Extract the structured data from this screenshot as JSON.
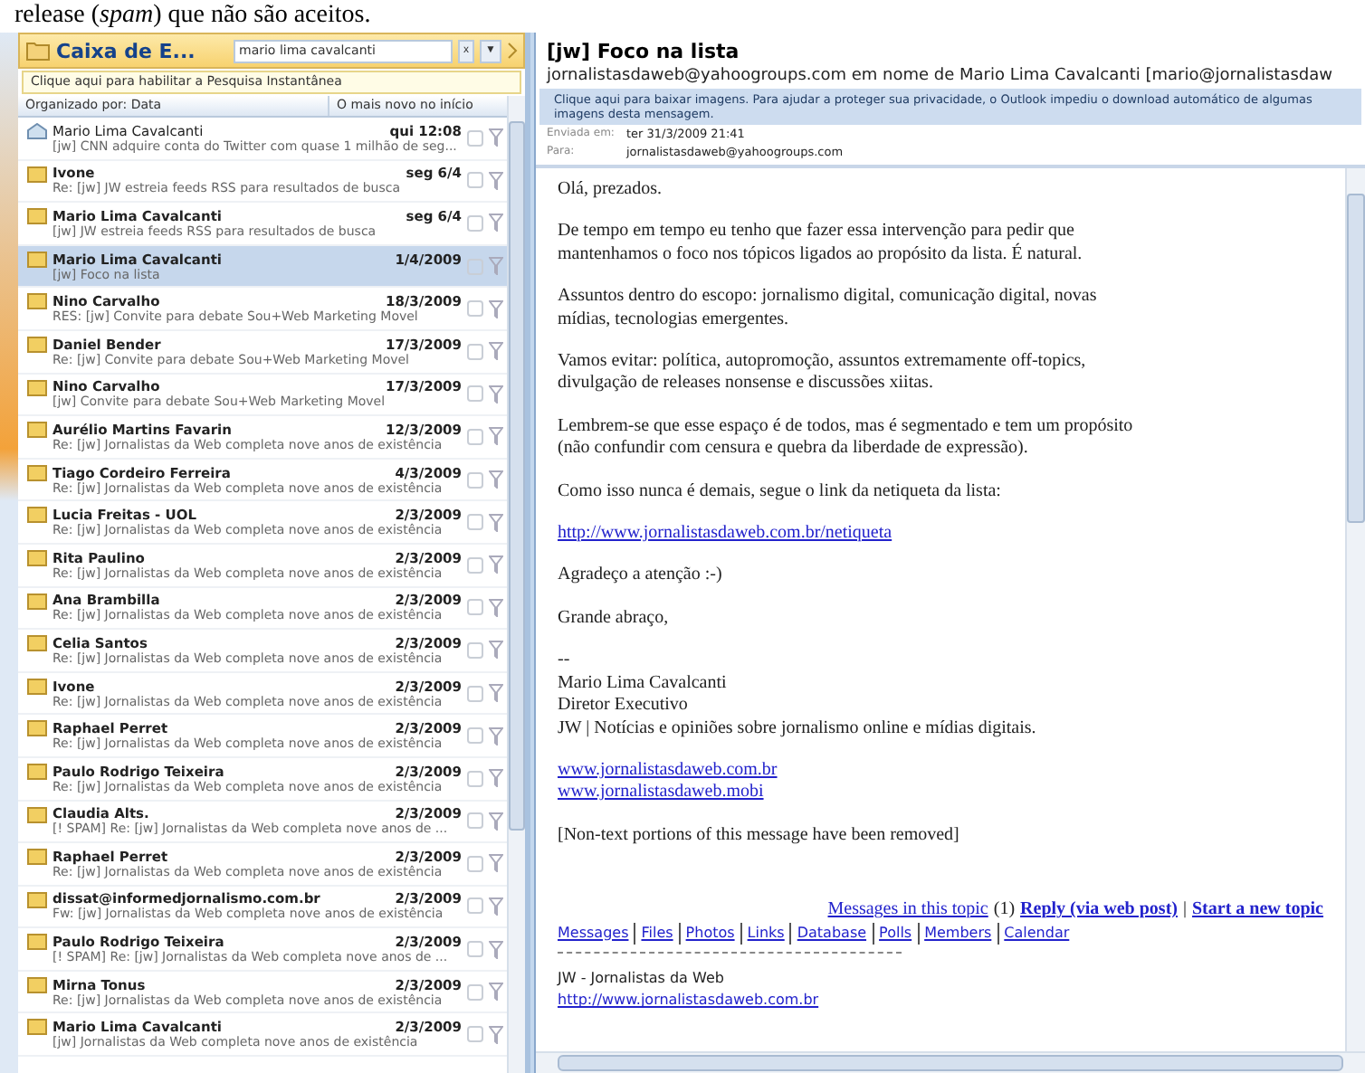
{
  "caption": "release (*spam*) que não são aceitos.",
  "mail_list": {
    "folder_title": "Caixa de E...",
    "search": {
      "value": "mario lima cavalcanti",
      "clear": "x",
      "dropdown": "▼"
    },
    "instant_search": "Clique aqui para habilitar a Pesquisa Instantânea",
    "sort": {
      "by": "Organizado por: Data",
      "order": "O mais novo no início"
    },
    "messages": [
      {
        "sender": "Mario Lima Cavalcanti",
        "date": "qui 12:08",
        "subject": "[jw] CNN adquire conta do Twitter com quase 1 milhão de seg...",
        "read": true,
        "selected": false
      },
      {
        "sender": "Ivone",
        "date": "seg 6/4",
        "subject": "Re: [jw] JW estreia feeds RSS para resultados de busca",
        "read": false,
        "selected": false
      },
      {
        "sender": "Mario Lima Cavalcanti",
        "date": "seg 6/4",
        "subject": "[jw] JW estreia feeds RSS para resultados de busca",
        "read": false,
        "selected": false
      },
      {
        "sender": "Mario Lima Cavalcanti",
        "date": "1/4/2009",
        "subject": "[jw] Foco na lista",
        "read": false,
        "selected": true
      },
      {
        "sender": "Nino Carvalho",
        "date": "18/3/2009",
        "subject": "RES: [jw] Convite para debate Sou+Web Marketing Movel",
        "read": false,
        "selected": false
      },
      {
        "sender": "Daniel Bender",
        "date": "17/3/2009",
        "subject": "Re: [jw] Convite para debate Sou+Web Marketing Movel",
        "read": false,
        "selected": false
      },
      {
        "sender": "Nino Carvalho",
        "date": "17/3/2009",
        "subject": "[jw] Convite para debate Sou+Web Marketing Movel",
        "read": false,
        "selected": false
      },
      {
        "sender": "Aurélio Martins Favarin",
        "date": "12/3/2009",
        "subject": "Re: [jw] Jornalistas da Web completa nove anos de existência",
        "read": false,
        "selected": false
      },
      {
        "sender": "Tiago Cordeiro Ferreira",
        "date": "4/3/2009",
        "subject": "Re: [jw] Jornalistas da Web completa nove anos de existência",
        "read": false,
        "selected": false
      },
      {
        "sender": "Lucia Freitas - UOL",
        "date": "2/3/2009",
        "subject": "Re: [jw] Jornalistas da Web completa nove anos de existência",
        "read": false,
        "selected": false
      },
      {
        "sender": "Rita Paulino",
        "date": "2/3/2009",
        "subject": "Re: [jw] Jornalistas da Web completa nove anos de existência",
        "read": false,
        "selected": false
      },
      {
        "sender": "Ana Brambilla",
        "date": "2/3/2009",
        "subject": "Re: [jw] Jornalistas da Web completa nove anos de existência",
        "read": false,
        "selected": false
      },
      {
        "sender": "Celia Santos",
        "date": "2/3/2009",
        "subject": "Re: [jw] Jornalistas da Web completa nove anos de existência",
        "read": false,
        "selected": false
      },
      {
        "sender": "Ivone",
        "date": "2/3/2009",
        "subject": "Re: [jw] Jornalistas da Web completa nove anos de existência",
        "read": false,
        "selected": false
      },
      {
        "sender": "Raphael Perret",
        "date": "2/3/2009",
        "subject": "Re: [jw] Jornalistas da Web completa nove anos de existência",
        "read": false,
        "selected": false
      },
      {
        "sender": "Paulo Rodrigo Teixeira",
        "date": "2/3/2009",
        "subject": "Re: [jw] Jornalistas da Web completa nove anos de existência",
        "read": false,
        "selected": false
      },
      {
        "sender": "Claudia Alts.",
        "date": "2/3/2009",
        "subject": "[! SPAM]  Re: [jw] Jornalistas da Web completa nove anos de ...",
        "read": false,
        "selected": false
      },
      {
        "sender": "Raphael Perret",
        "date": "2/3/2009",
        "subject": "Re: [jw] Jornalistas da Web completa nove anos de existência",
        "read": false,
        "selected": false
      },
      {
        "sender": "dissat@informedjornalismo.com.br",
        "date": "2/3/2009",
        "subject": "Fw: [jw] Jornalistas da Web completa nove anos de existência",
        "read": false,
        "selected": false
      },
      {
        "sender": "Paulo Rodrigo Teixeira",
        "date": "2/3/2009",
        "subject": "[! SPAM]  Re: [jw] Jornalistas da Web completa nove anos de ...",
        "read": false,
        "selected": false
      },
      {
        "sender": "Mirna Tonus",
        "date": "2/3/2009",
        "subject": "Re: [jw] Jornalistas da Web completa nove anos de existência",
        "read": false,
        "selected": false
      },
      {
        "sender": "Mario Lima Cavalcanti",
        "date": "2/3/2009",
        "subject": "[jw] Jornalistas da Web completa nove anos de existência",
        "read": false,
        "selected": false
      }
    ]
  },
  "reading_pane": {
    "subject": "[jw] Foco na lista",
    "from": "jornalistasdaweb@yahoogroups.com em nome de Mario Lima Cavalcanti [mario@jornalistasdaw",
    "infobar": "Clique aqui para baixar imagens. Para ajudar a proteger sua privacidade, o Outlook impediu o download automático de algumas imagens desta mensagem.",
    "sent_label": "Enviada em:",
    "sent": "ter 31/3/2009 21:41",
    "to_label": "Para:",
    "to": "jornalistasdaweb@yahoogroups.com",
    "body": [
      {
        "kind": "text",
        "lines": [
          "Olá, prezados."
        ]
      },
      {
        "kind": "text",
        "lines": [
          "De tempo em tempo eu tenho que fazer essa intervenção para pedir que",
          "mantenhamos o foco nos tópicos ligados ao propósito da lista. É natural."
        ]
      },
      {
        "kind": "text",
        "lines": [
          "Assuntos dentro do escopo: jornalismo digital, comunicação digital, novas",
          "mídias, tecnologias emergentes."
        ]
      },
      {
        "kind": "text",
        "lines": [
          "Vamos evitar: política, autopromoção, assuntos extremamente off-topics,",
          "divulgação de releases nonsense e discussões xiitas."
        ]
      },
      {
        "kind": "text",
        "lines": [
          "Lembrem-se que esse espaço é de todos, mas é segmentado e tem um propósito",
          "(não confundir com censura e quebra da liberdade de expressão)."
        ]
      },
      {
        "kind": "text",
        "lines": [
          "Como isso nunca é demais, segue o link da netiqueta da lista:"
        ]
      },
      {
        "kind": "link",
        "lines": [
          "http://www.jornalistasdaweb.com.br/netiqueta"
        ]
      },
      {
        "kind": "text",
        "lines": [
          "Agradeço a atenção :-)"
        ]
      },
      {
        "kind": "text",
        "lines": [
          "Grande abraço,"
        ]
      },
      {
        "kind": "text",
        "lines": [
          "--",
          "Mario Lima Cavalcanti",
          "Diretor Executivo",
          "JW | Notícias e opiniões sobre jornalismo online e mídias digitais."
        ]
      },
      {
        "kind": "link",
        "lines": [
          "www.jornalistasdaweb.com.br"
        ]
      },
      {
        "kind": "link",
        "lines": [
          "www.jornalistasdaweb.mobi"
        ]
      },
      {
        "kind": "text",
        "lines": [
          "[Non-text portions of this message have been removed]"
        ]
      }
    ],
    "topic_bar": [
      {
        "kind": "link",
        "text": "Messages in this topic"
      },
      {
        "kind": "text",
        "text": "(1)"
      },
      {
        "kind": "bold-link",
        "text": "Reply (via web post)"
      },
      {
        "kind": "text",
        "text": "|"
      },
      {
        "kind": "bold-link",
        "text": "Start a new topic"
      }
    ],
    "nav_links": [
      "Messages",
      "Files",
      "Photos",
      "Links",
      "Database",
      "Polls",
      "Members",
      "Calendar"
    ],
    "group_name": "JW - Jornalistas da Web",
    "group_url": "http://www.jornalistasdaweb.com.br"
  }
}
